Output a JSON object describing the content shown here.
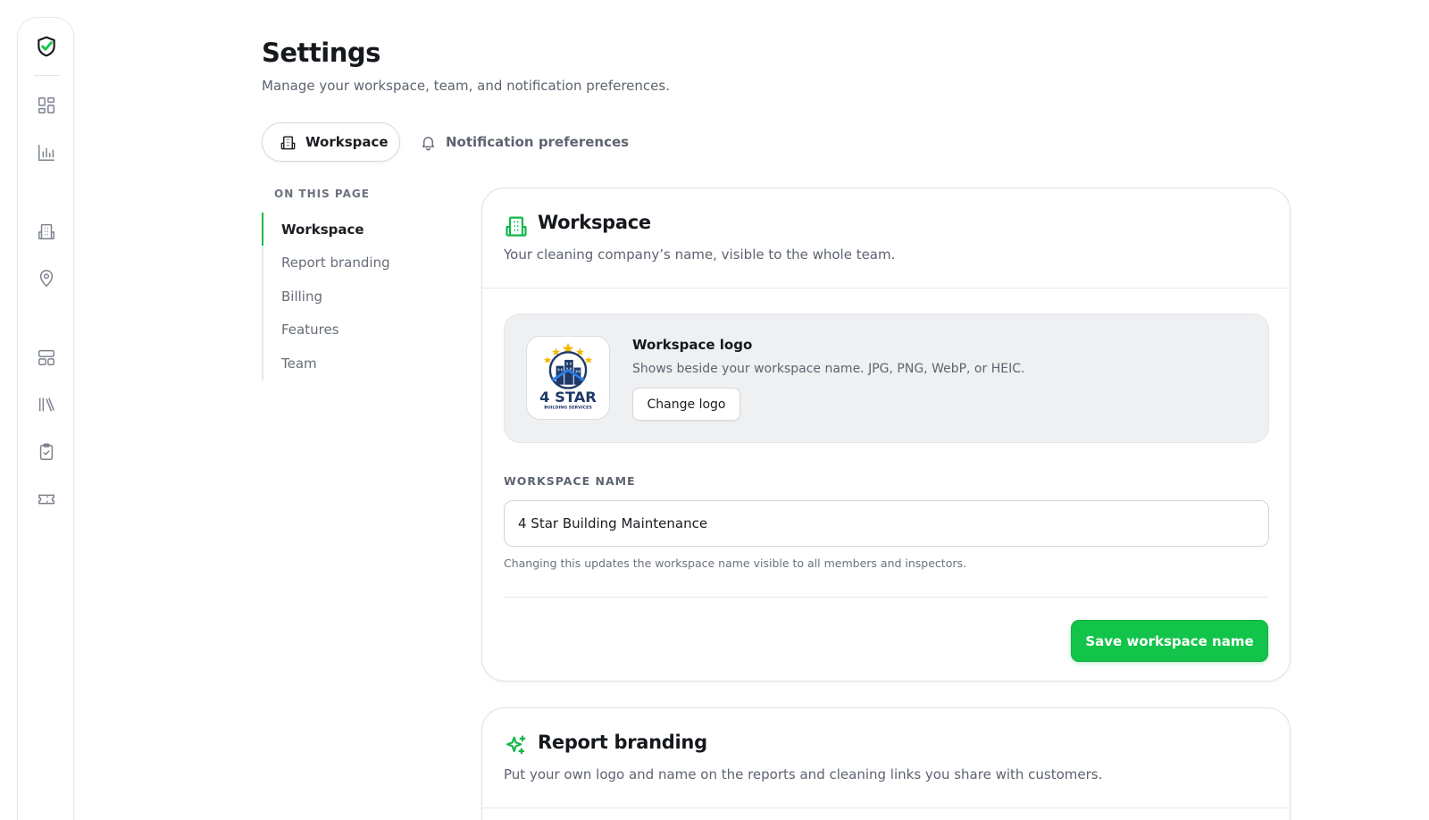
{
  "header": {
    "title": "Settings",
    "subtitle": "Manage your workspace, team, and notification preferences."
  },
  "tabs": [
    {
      "label": "Workspace",
      "icon": "building-icon",
      "active": true
    },
    {
      "label": "Notification preferences",
      "icon": "bell-icon",
      "active": false
    }
  ],
  "on_this_page": {
    "heading": "ON THIS PAGE",
    "items": [
      {
        "label": "Workspace",
        "active": true
      },
      {
        "label": "Report branding",
        "active": false
      },
      {
        "label": "Billing",
        "active": false
      },
      {
        "label": "Features",
        "active": false
      },
      {
        "label": "Team",
        "active": false
      }
    ]
  },
  "sidebar": {
    "items": [
      "shield-check-icon",
      "dashboard-grid-icon",
      "bar-chart-icon",
      "building-icon",
      "map-pin-icon",
      "layout-icon",
      "library-icon",
      "clipboard-check-icon",
      "ticket-icon"
    ]
  },
  "workspace_card": {
    "title": "Workspace",
    "description": "Your cleaning company’s name, visible to the whole team.",
    "logo": {
      "title": "Workspace logo",
      "description": "Shows beside your workspace name. JPG, PNG, WebP, or HEIC.",
      "button_label": "Change logo",
      "brand_text": "4 STAR",
      "brand_subtext": "BUILDING SERVICES"
    },
    "field_label": "WORKSPACE NAME",
    "field_value": "4 Star Building Maintenance",
    "field_help": "Changing this updates the workspace name visible to all members and inspectors.",
    "save_label": "Save workspace name"
  },
  "branding_card": {
    "title": "Report branding",
    "description": "Put your own logo and name on the reports and cleaning links you share with customers."
  },
  "colors": {
    "accent": "#12c44a",
    "text": "#1a1d21",
    "muted": "#5d6470"
  }
}
